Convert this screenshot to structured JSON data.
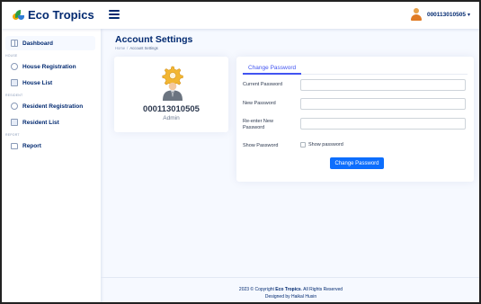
{
  "brand": {
    "name": "Eco Tropics"
  },
  "user": {
    "name": "000113010505"
  },
  "sidebar": {
    "items": [
      {
        "label": "Dashboard",
        "heading": ""
      },
      {
        "label": "House Registration",
        "heading": "House"
      },
      {
        "label": "House List",
        "heading": ""
      },
      {
        "label": "Resident Registration",
        "heading": "Resident"
      },
      {
        "label": "Resident List",
        "heading": ""
      },
      {
        "label": "Report",
        "heading": "Report"
      }
    ]
  },
  "page": {
    "title": "Account Settings",
    "breadcrumb": {
      "home": "Home",
      "separator": "/",
      "current": "Account Settings"
    }
  },
  "profile": {
    "id": "000113010505",
    "role": "Admin"
  },
  "settings": {
    "tab": "Change Password",
    "fields": {
      "current": {
        "label": "Current Password",
        "value": ""
      },
      "new": {
        "label": "New Password",
        "value": ""
      },
      "reenter": {
        "label": "Re-enter New Password",
        "value": ""
      }
    },
    "show_password": {
      "label": "Show Password",
      "checkbox_label": "Show password",
      "checked": false
    },
    "submit_label": "Change Password"
  },
  "footer": {
    "copyright_prefix": "2023 © Copyright",
    "copyright_brand": "Eco Tropics",
    "copyright_suffix": ". All Rights Reserved",
    "designed_by": "Designed by Haikal Husin"
  },
  "colors": {
    "primary": "#4154f1",
    "button": "#0d6efd",
    "navy": "#012970",
    "background": "#f6f9ff"
  },
  "icons": {
    "menu": "hamburger-icon",
    "dashboard": "grid-icon",
    "house_registration": "circle-plus-icon",
    "house_list": "list-icon",
    "resident_registration": "circle-plus-icon",
    "resident_list": "list-icon",
    "report": "folder-icon",
    "profile": "gear-person-icon"
  }
}
